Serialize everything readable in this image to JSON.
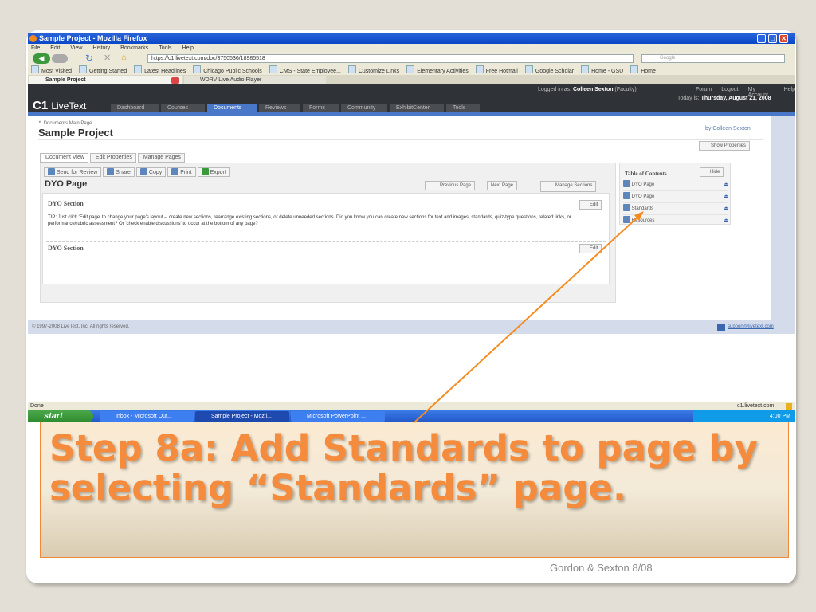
{
  "window": {
    "title": "Sample Project - Mozilla Firefox"
  },
  "menu": [
    "File",
    "Edit",
    "View",
    "History",
    "Bookmarks",
    "Tools",
    "Help"
  ],
  "url": "https://c1.livetext.com/doc/3750536/18985518",
  "search_placeholder": "Google",
  "bookmarks": [
    "Most Visited",
    "Getting Started",
    "Latest Headlines",
    "Chicago Public Schools",
    "CMS - State Employee...",
    "Customize Links",
    "Elementary Activities",
    "Free Hotmail",
    "Google Scholar",
    "Home - GSU",
    "Home"
  ],
  "browser_tabs": [
    "Sample Project",
    "WDRV Live Audio Player"
  ],
  "app": {
    "logo": "C1 by LiveText",
    "nav": [
      "Dashboard",
      "Courses",
      "Documents",
      "Reviews",
      "Forms",
      "Community",
      "ExhibitCenter",
      "Tools"
    ],
    "active_nav": "Documents",
    "logged_in_label": "Logged in as:",
    "user": "Colleen Sexton",
    "role": "(Faculty)",
    "top_links": [
      "Forum",
      "Logout",
      "My Account",
      "Help"
    ],
    "today_label": "Today is:",
    "today": "Thursday, August 21, 2008"
  },
  "page": {
    "breadcrumb": "Documents Main Page",
    "title": "Sample Project",
    "byline": "by Colleen Sexton",
    "show_properties": "Show Properties",
    "tabs": [
      "Document View",
      "Edit Properties",
      "Manage Pages"
    ],
    "toolbar": [
      "Send for Review",
      "Share",
      "Copy",
      "Print",
      "Export"
    ],
    "page_name": "DYO Page",
    "prev": "Previous Page",
    "next": "Next Page",
    "manage_sections": "Manage Sections",
    "sections": [
      {
        "title": "DYO Section",
        "edit": "Edit",
        "body": "TIP: Just click 'Edit page' to change your page's layout -- create new sections, rearrange existing sections, or delete unneeded sections.  Did you know you can create new sections for text and images, standards, quiz-type questions, related links, or performance/rubric assessment? Or 'check enable discussions' to occur at the bottom of any page?"
      },
      {
        "title": "DYO Section",
        "edit": "Edit",
        "body": ""
      }
    ],
    "toc": {
      "title": "Table of Contents",
      "hide": "Hide",
      "items": [
        "DYO Page",
        "DYO Page",
        "Standards",
        "Resources"
      ]
    }
  },
  "footer": {
    "copyright": "© 1997-2008 LiveText, Inc. All rights reserved.",
    "support": "support@livetext.com"
  },
  "status": {
    "left": "Done",
    "right": "c1.livetext.com"
  },
  "taskbar": {
    "start": "start",
    "items": [
      "Inbox - Microsoft Out...",
      "Sample Project - Mozil...",
      "Microsoft PowerPoint ..."
    ],
    "clock": "4:00 PM"
  },
  "slide": {
    "title": "Step 8a: Add Standards to page by selecting “Standards” page.",
    "credit": "Gordon & Sexton 8/08",
    "accent": "#f58b3c"
  }
}
